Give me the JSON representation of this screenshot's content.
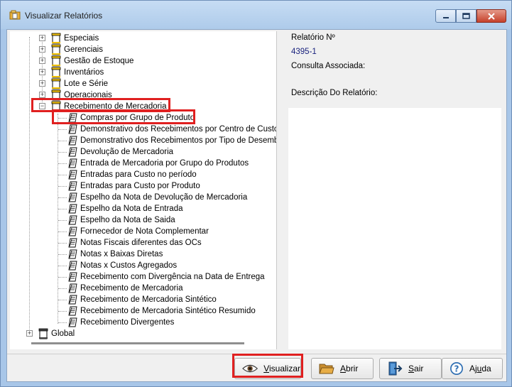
{
  "window": {
    "title": "Visualizar Relatórios"
  },
  "tree": {
    "categories": [
      {
        "label": "Especiais",
        "expanded": false
      },
      {
        "label": "Gerenciais",
        "expanded": false
      },
      {
        "label": "Gestão de Estoque",
        "expanded": false
      },
      {
        "label": "Inventários",
        "expanded": false
      },
      {
        "label": "Lote e Série",
        "expanded": false
      },
      {
        "label": "Operacionais",
        "expanded": false
      },
      {
        "label": "Recebimento de Mercadoria",
        "expanded": true
      }
    ],
    "reports": [
      "Compras por Grupo de Produto",
      "Demonstrativo dos Recebimentos por Centro de Custo",
      "Demonstrativo dos Recebimentos por Tipo de Desembolso",
      "Devolução de Mercadoria",
      "Entrada de Mercadoria por Grupo do Produtos",
      "Entradas para Custo no período",
      "Entradas para Custo por Produto",
      "Espelho da Nota de Devolução de Mercadoria",
      "Espelho da Nota de Entrada",
      "Espelho da Nota de Saida",
      "Fornecedor de Nota Complementar",
      "Notas Fiscais diferentes das OCs",
      "Notas x Baixas Diretas",
      "Notas x Custos Agregados",
      "Recebimento com Divergência na Data de Entrega",
      "Recebimento de Mercadoria",
      "Recebimento de Mercadoria Sintético",
      "Recebimento de Mercadoria Sintético Resumido",
      "Recebimento Divergentes"
    ],
    "root_sibling": "Global",
    "selected_report": "Compras por Grupo de Produto"
  },
  "details": {
    "report_number_label": "Relatório Nº",
    "report_number_value": "4395-1",
    "query_label": "Consulta Associada:",
    "description_label": "Descrição Do Relatório:"
  },
  "buttons": {
    "visualizar": {
      "pre": "",
      "ul": "V",
      "post": "isualizar"
    },
    "abrir": {
      "pre": "",
      "ul": "A",
      "post": "brir"
    },
    "sair": {
      "pre": "",
      "ul": "S",
      "post": "air"
    },
    "ajuda": {
      "pre": "Aj",
      "ul": "u",
      "post": "da"
    }
  },
  "colors": {
    "highlight": "#e02020",
    "value_text": "#1a237e"
  }
}
